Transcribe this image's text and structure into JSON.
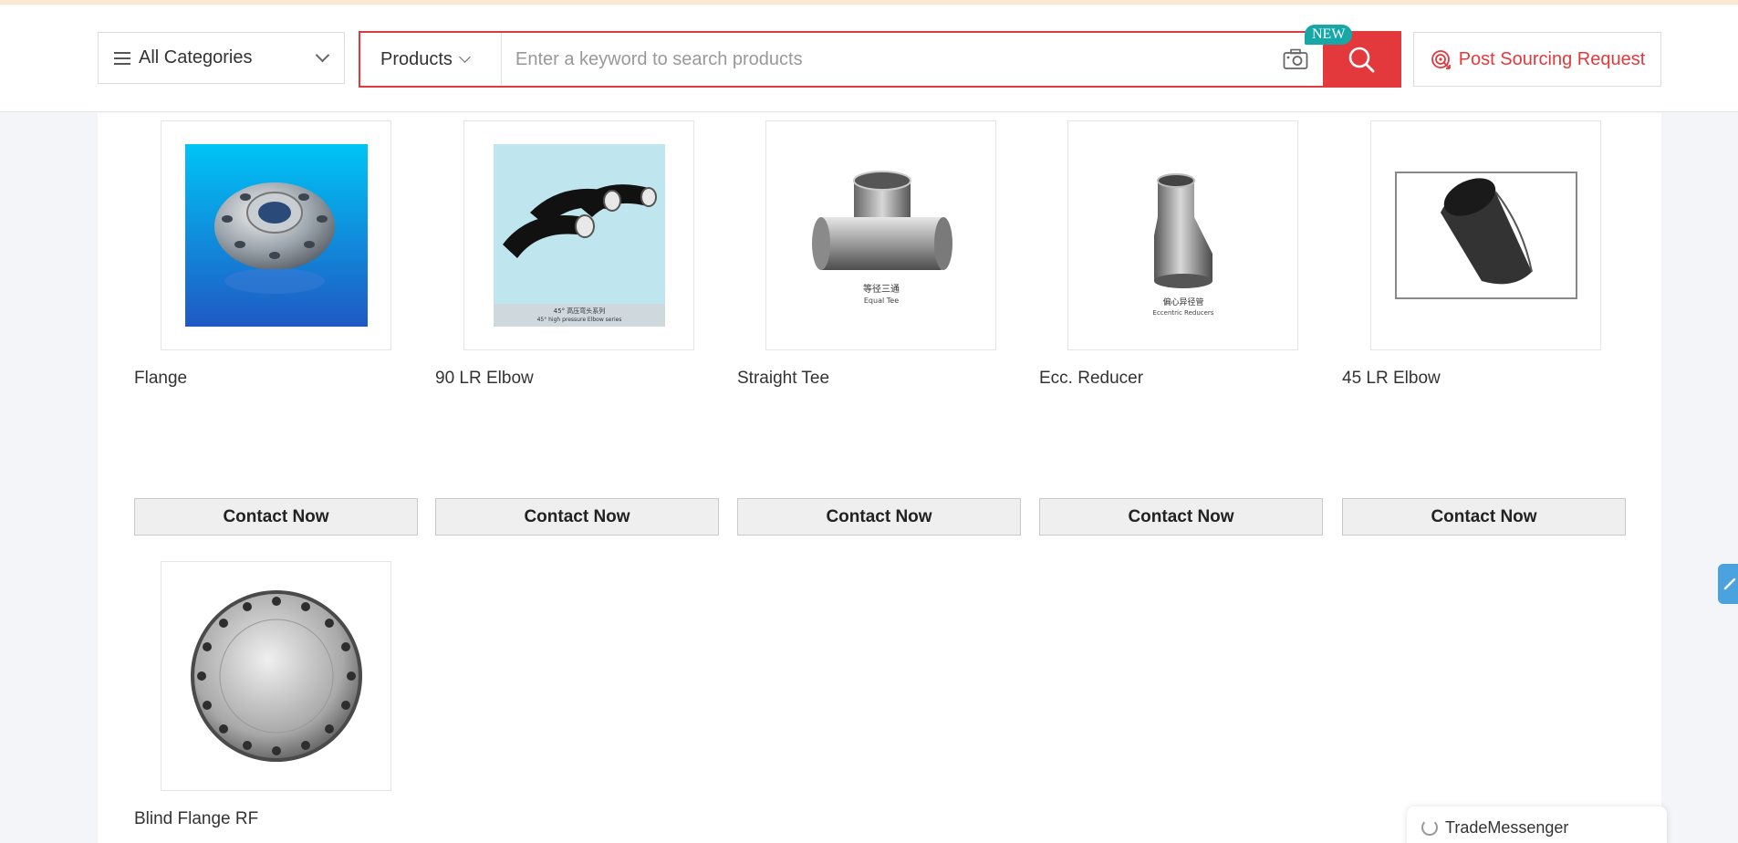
{
  "header": {
    "categories_label": "All Categories",
    "scope_label": "Products",
    "search_placeholder": "Enter a keyword to search products",
    "search_value": "",
    "new_badge": "NEW",
    "post_label": "Post Sourcing Request"
  },
  "products": [
    {
      "name": "Flange",
      "icon": "flange-image"
    },
    {
      "name": "90 LR Elbow",
      "icon": "elbow-90-image",
      "caption1": "45° 高压弯头系列",
      "caption2": "45° high pressure Elbow series"
    },
    {
      "name": "Straight Tee",
      "icon": "tee-image",
      "caption1": "等径三通",
      "caption2": "Equal Tee"
    },
    {
      "name": "Ecc. Reducer",
      "icon": "reducer-image",
      "caption1": "偏心异径管",
      "caption2": "Eccentric Reducers"
    },
    {
      "name": "45 LR Elbow",
      "icon": "elbow-45-image"
    },
    {
      "name": "Blind Flange RF",
      "icon": "blind-flange-image"
    }
  ],
  "contact_label": "Contact Now",
  "messenger": {
    "label": "TradeMessenger"
  },
  "colors": {
    "accent": "#e4393c",
    "badge": "#17a7a7",
    "side_tab": "#4aa3df"
  }
}
